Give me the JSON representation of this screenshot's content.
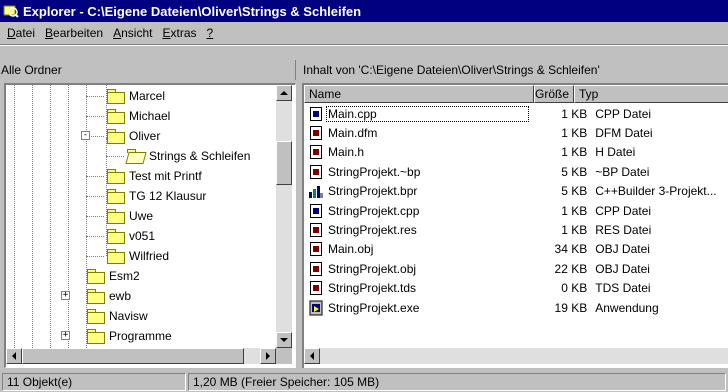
{
  "window": {
    "title": "Explorer - C:\\Eigene Dateien\\Oliver\\Strings & Schleifen"
  },
  "menu": [
    {
      "pre": "",
      "key": "D",
      "post": "atei"
    },
    {
      "pre": "",
      "key": "B",
      "post": "earbeiten"
    },
    {
      "pre": "",
      "key": "A",
      "post": "nsicht"
    },
    {
      "pre": "",
      "key": "E",
      "post": "xtras"
    },
    {
      "pre": "",
      "key": "?",
      "post": ""
    }
  ],
  "tree": {
    "header": "Alle Ordner",
    "items": [
      {
        "label": "Marcel",
        "level": 2,
        "open": false,
        "expander": ""
      },
      {
        "label": "Michael",
        "level": 2,
        "open": false,
        "expander": ""
      },
      {
        "label": "Oliver",
        "level": 2,
        "open": false,
        "expander": "-"
      },
      {
        "label": "Strings & Schleifen",
        "level": 3,
        "open": true,
        "expander": ""
      },
      {
        "label": "Test mit Printf",
        "level": 2,
        "open": false,
        "expander": ""
      },
      {
        "label": "TG 12 Klausur",
        "level": 2,
        "open": false,
        "expander": ""
      },
      {
        "label": "Uwe",
        "level": 2,
        "open": false,
        "expander": ""
      },
      {
        "label": "v051",
        "level": 2,
        "open": false,
        "expander": ""
      },
      {
        "label": "Wilfried",
        "level": 2,
        "open": false,
        "expander": ""
      },
      {
        "label": "Esm2",
        "level": 1,
        "open": false,
        "expander": ""
      },
      {
        "label": "ewb",
        "level": 1,
        "open": false,
        "expander": "+"
      },
      {
        "label": "Navisw",
        "level": 1,
        "open": false,
        "expander": ""
      },
      {
        "label": "Programme",
        "level": 1,
        "open": false,
        "expander": "+"
      }
    ]
  },
  "list": {
    "header": "Inhalt von 'C:\\Eigene Dateien\\Oliver\\Strings & Schleifen'",
    "columns": {
      "name": "Name",
      "size": "Größe",
      "type": "Typ"
    },
    "files": [
      {
        "name": "Main.cpp",
        "size": "1 KB",
        "type": "CPP Datei",
        "icon": "cpp-file-icon"
      },
      {
        "name": "Main.dfm",
        "size": "1 KB",
        "type": "DFM Datei",
        "icon": "generic-file-icon"
      },
      {
        "name": "Main.h",
        "size": "1 KB",
        "type": "H Datei",
        "icon": "generic-file-icon"
      },
      {
        "name": "StringProjekt.~bp",
        "size": "5 KB",
        "type": "~BP Datei",
        "icon": "generic-file-icon"
      },
      {
        "name": "StringProjekt.bpr",
        "size": "5 KB",
        "type": "C++Builder 3-Projekt...",
        "icon": "builder-project-icon"
      },
      {
        "name": "StringProjekt.cpp",
        "size": "1 KB",
        "type": "CPP Datei",
        "icon": "cpp-file-icon"
      },
      {
        "name": "StringProjekt.res",
        "size": "1 KB",
        "type": "RES Datei",
        "icon": "generic-file-icon"
      },
      {
        "name": "Main.obj",
        "size": "34 KB",
        "type": "OBJ Datei",
        "icon": "generic-file-icon"
      },
      {
        "name": "StringProjekt.obj",
        "size": "22 KB",
        "type": "OBJ Datei",
        "icon": "generic-file-icon"
      },
      {
        "name": "StringProjekt.tds",
        "size": "0 KB",
        "type": "TDS Datei",
        "icon": "generic-file-icon"
      },
      {
        "name": "StringProjekt.exe",
        "size": "19 KB",
        "type": "Anwendung",
        "icon": "exe-file-icon"
      }
    ]
  },
  "status": {
    "count": "11 Objekt(e)",
    "info": "1,20 MB (Freier Speicher: 105 MB)"
  },
  "colors": {
    "titlebar": "#000080",
    "face": "#c0c0c0",
    "folder": "#ffff80"
  }
}
